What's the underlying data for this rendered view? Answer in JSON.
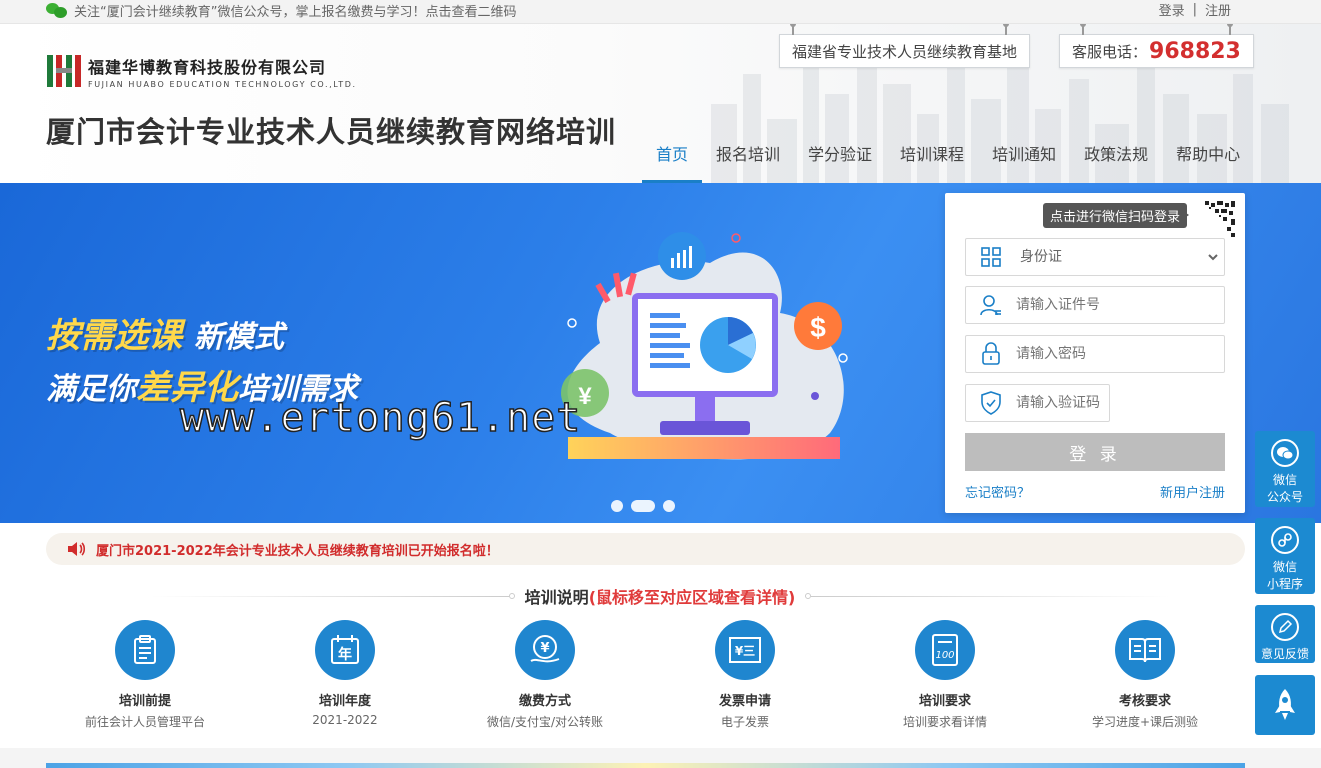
{
  "topbar": {
    "notice": "关注“厦门会计继续教育”微信公众号，掌上报名缴费与学习！点击查看二维码",
    "login": "登录",
    "separator": "|",
    "register": "注册"
  },
  "header": {
    "company_cn": "福建华博教育科技股份有限公司",
    "company_en": "FUJIAN HUABO EDUCATION TECHNOLOGY CO.,LTD.",
    "site_title": "厦门市会计专业技术人员继续教育网络培训",
    "base_label": "福建省专业技术人员继续教育基地",
    "service_label": "客服电话：",
    "service_phone": "968823"
  },
  "nav": [
    {
      "label": "首页",
      "active": true
    },
    {
      "label": "报名培训"
    },
    {
      "label": "学分验证"
    },
    {
      "label": "培训课程"
    },
    {
      "label": "培训通知"
    },
    {
      "label": "政策法规"
    },
    {
      "label": "帮助中心"
    }
  ],
  "banner": {
    "line1_highlight": "按需选课",
    "line1_rest": "新模式",
    "line2_start": "满足你",
    "line2_highlight": "差异化",
    "line2_end": "培训需求",
    "watermark": "www.ertong61.net",
    "slide_count": 3,
    "active_slide": 1
  },
  "login": {
    "qr_tip": "点击进行微信扫码登录",
    "id_type_selected": "身份证",
    "id_placeholder": "请输入证件号",
    "password_placeholder": "请输入密码",
    "captcha_placeholder": "请输入验证码",
    "submit_label": "登 录",
    "forgot_label": "忘记密码？",
    "register_label": "新用户注册"
  },
  "announcement": {
    "text": "厦门市2021-2022年会计专业技术人员继续教育培训已开始报名啦！"
  },
  "section": {
    "title": "培训说明",
    "hint": "(鼠标移至对应区域查看详情)"
  },
  "features": [
    {
      "name": "培训前提",
      "desc": "前往会计人员管理平台",
      "icon": "clipboard-icon"
    },
    {
      "name": "培训年度",
      "desc": "2021-2022",
      "icon": "calendar-icon",
      "glyph": "年"
    },
    {
      "name": "缴费方式",
      "desc": "微信/支付宝/对公转账",
      "icon": "payment-icon",
      "glyph": "¥"
    },
    {
      "name": "发票申请",
      "desc": "电子发票",
      "icon": "invoice-icon",
      "glyph": "¥三"
    },
    {
      "name": "培训要求",
      "desc": "培训要求看详情",
      "icon": "score-100-icon",
      "glyph": "100"
    },
    {
      "name": "考核要求",
      "desc": "学习进度+课后测验",
      "icon": "book-icon"
    }
  ],
  "sidebar": [
    {
      "label1": "微信",
      "label2": "公众号",
      "icon": "wechat-icon"
    },
    {
      "label1": "微信",
      "label2": "小程序",
      "icon": "mini-program-icon"
    },
    {
      "label1": "意见反馈",
      "label2": "",
      "icon": "feedback-icon"
    },
    {
      "label1": "",
      "label2": "",
      "icon": "rocket-icon"
    }
  ],
  "colors": {
    "primary": "#1a7fc7",
    "phone_red": "#d32f2f",
    "announce_red": "#d12c2c",
    "banner_blue": "#2c7fe9",
    "slogan_yellow": "#ffd84a"
  }
}
